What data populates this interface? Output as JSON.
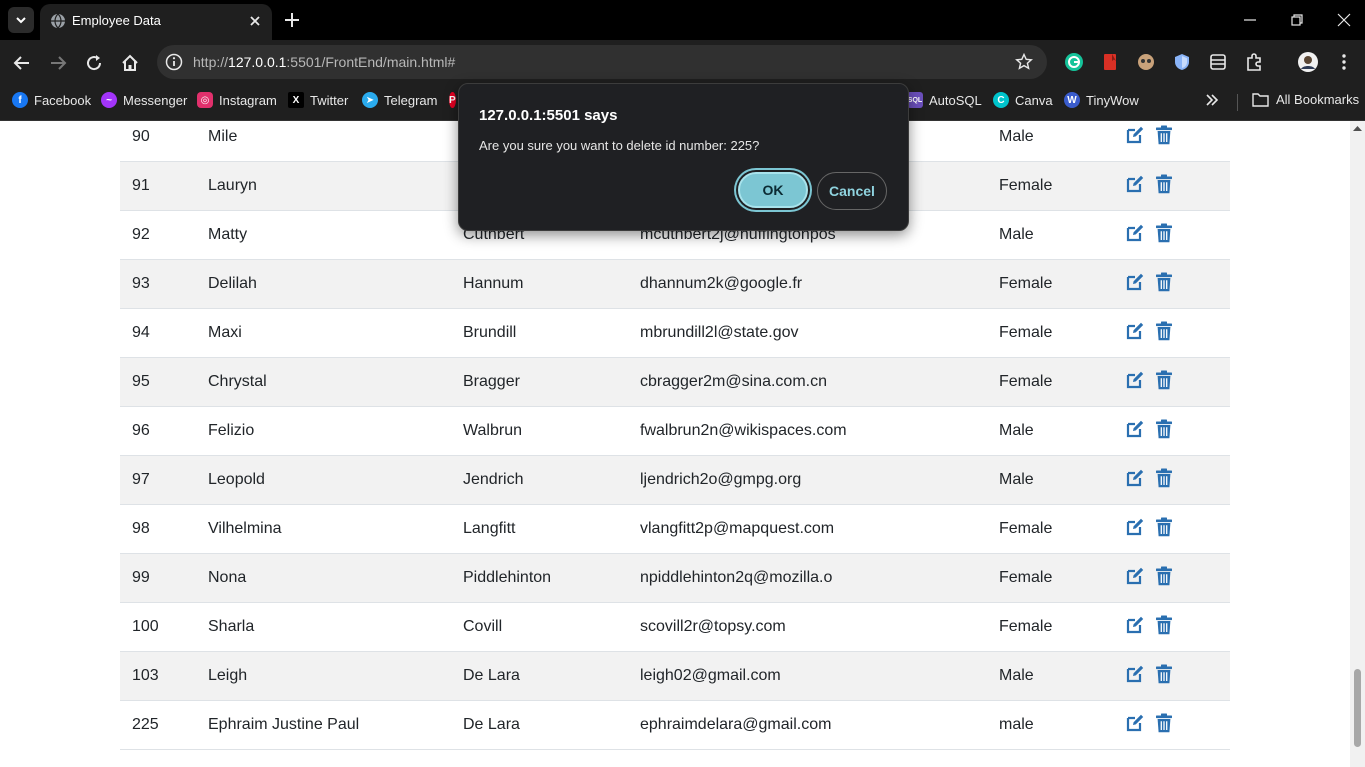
{
  "browser": {
    "tab_title": "Employee Data",
    "url_prefix": "http://",
    "url_host": "127.0.0.1",
    "url_rest": ":5501/FrontEnd/main.html#"
  },
  "bookmarks": [
    {
      "label": "Facebook",
      "icon": "facebook-icon",
      "color": "#1877f2"
    },
    {
      "label": "Messenger",
      "icon": "messenger-icon",
      "color": "#a334fa"
    },
    {
      "label": "Instagram",
      "icon": "instagram-icon",
      "color": "#e1306c"
    },
    {
      "label": "Twitter",
      "icon": "x-icon",
      "color": "#000000"
    },
    {
      "label": "Telegram",
      "icon": "telegram-icon",
      "color": "#2aabee"
    },
    {
      "label": "AutoSQL",
      "icon": "autosql-icon",
      "color": "#6b4fbb"
    },
    {
      "label": "Canva",
      "icon": "canva-icon",
      "color": "#00c4cc"
    },
    {
      "label": "TinyWow",
      "icon": "tinywow-icon",
      "color": "#3a5ccc"
    }
  ],
  "all_bookmarks_label": "All Bookmarks",
  "dialog": {
    "title": "127.0.0.1:5501 says",
    "message": "Are you sure you want to delete id number: 225?",
    "ok_label": "OK",
    "cancel_label": "Cancel"
  },
  "colors": {
    "action_icon": "#2a6fb0",
    "ok_button": "#7cc6d3"
  },
  "rows": [
    {
      "id": "90",
      "first": "Mile",
      "last": "",
      "email": "",
      "gender": "Male"
    },
    {
      "id": "91",
      "first": "Lauryn",
      "last": "",
      "email": "",
      "gender": "Female"
    },
    {
      "id": "92",
      "first": "Matty",
      "last": "Cuthbert",
      "email": "mcuthbert2j@huffingtonpos",
      "gender": "Male"
    },
    {
      "id": "93",
      "first": "Delilah",
      "last": "Hannum",
      "email": "dhannum2k@google.fr",
      "gender": "Female"
    },
    {
      "id": "94",
      "first": "Maxi",
      "last": "Brundill",
      "email": "mbrundill2l@state.gov",
      "gender": "Female"
    },
    {
      "id": "95",
      "first": "Chrystal",
      "last": "Bragger",
      "email": "cbragger2m@sina.com.cn",
      "gender": "Female"
    },
    {
      "id": "96",
      "first": "Felizio",
      "last": "Walbrun",
      "email": "fwalbrun2n@wikispaces.com",
      "gender": "Male"
    },
    {
      "id": "97",
      "first": "Leopold",
      "last": "Jendrich",
      "email": "ljendrich2o@gmpg.org",
      "gender": "Male"
    },
    {
      "id": "98",
      "first": "Vilhelmina",
      "last": "Langfitt",
      "email": "vlangfitt2p@mapquest.com",
      "gender": "Female"
    },
    {
      "id": "99",
      "first": "Nona",
      "last": "Piddlehinton",
      "email": "npiddlehinton2q@mozilla.o",
      "gender": "Female"
    },
    {
      "id": "100",
      "first": "Sharla",
      "last": "Covill",
      "email": "scovill2r@topsy.com",
      "gender": "Female"
    },
    {
      "id": "103",
      "first": "Leigh",
      "last": "De Lara",
      "email": "leigh02@gmail.com",
      "gender": "Male"
    },
    {
      "id": "225",
      "first": "Ephraim Justine Paul",
      "last": "De Lara",
      "email": "ephraimdelara@gmail.com",
      "gender": "male"
    }
  ]
}
